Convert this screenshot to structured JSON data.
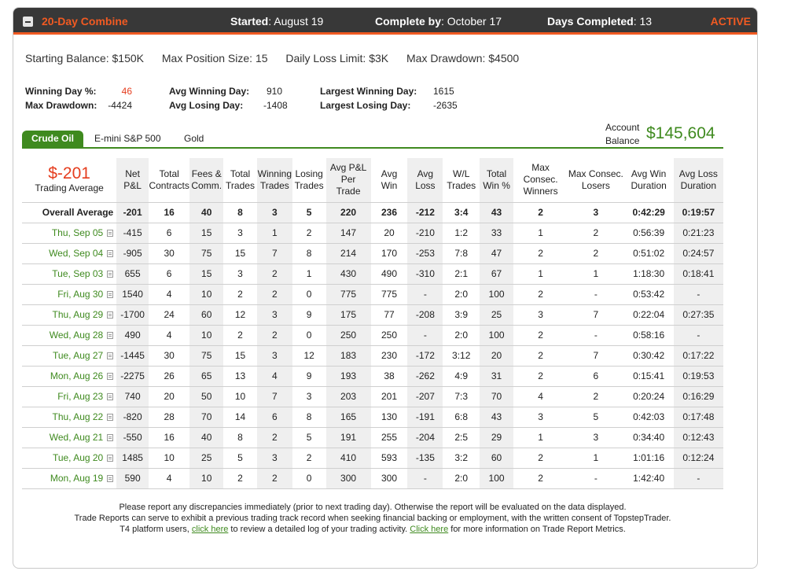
{
  "header": {
    "title": "20-Day Combine",
    "started_label": "Started",
    "started_value": "August 19",
    "complete_label": "Complete by",
    "complete_value": "October 17",
    "days_label": "Days Completed",
    "days_value": "13",
    "status": "ACTIVE"
  },
  "params": {
    "starting_balance": "Starting Balance: $150K",
    "max_position": "Max Position Size: 15",
    "daily_loss": "Daily Loss Limit: $3K",
    "max_drawdown": "Max Drawdown: $4500"
  },
  "stats": {
    "winning_day_label": "Winning Day %:",
    "winning_day_value": "46",
    "max_drawdown_label": "Max Drawdown:",
    "max_drawdown_value": "-4424",
    "avg_winning_label": "Avg Winning Day:",
    "avg_winning_value": "910",
    "avg_losing_label": "Avg Losing Day:",
    "avg_losing_value": "-1408",
    "largest_winning_label": "Largest Winning Day:",
    "largest_winning_value": "1615",
    "largest_losing_label": "Largest Losing Day:",
    "largest_losing_value": "-2635"
  },
  "tabs": [
    "Crude Oil",
    "E-mini S&P 500",
    "Gold"
  ],
  "account": {
    "label1": "Account",
    "label2": "Balance",
    "value": "$145,604"
  },
  "table": {
    "pnl_big": "$-201",
    "pnl_small": "Trading Average",
    "columns": [
      [
        "Net",
        "P&L"
      ],
      [
        "Total",
        "Contracts"
      ],
      [
        "Fees &",
        "Comm."
      ],
      [
        "Total",
        "Trades"
      ],
      [
        "Winning",
        "Trades"
      ],
      [
        "Losing",
        "Trades"
      ],
      [
        "Avg P&L",
        "Per",
        "Trade"
      ],
      [
        "Avg",
        "Win"
      ],
      [
        "Avg",
        "Loss"
      ],
      [
        "W/L",
        "Trades"
      ],
      [
        "Total",
        "Win %"
      ],
      [
        "Max Consec.",
        "Winners"
      ],
      [
        "Max Consec.",
        "Losers"
      ],
      [
        "Avg Win",
        "Duration"
      ],
      [
        "Avg Loss",
        "Duration"
      ]
    ],
    "overall": [
      "Overall Average",
      "-201",
      "16",
      "40",
      "8",
      "3",
      "5",
      "220",
      "236",
      "-212",
      "3:4",
      "43",
      "2",
      "3",
      "0:42:29",
      "0:19:57"
    ],
    "rows": [
      [
        "Thu, Sep 05",
        "-415",
        "6",
        "15",
        "3",
        "1",
        "2",
        "147",
        "20",
        "-210",
        "1:2",
        "33",
        "1",
        "2",
        "0:56:39",
        "0:21:23"
      ],
      [
        "Wed, Sep 04",
        "-905",
        "30",
        "75",
        "15",
        "7",
        "8",
        "214",
        "170",
        "-253",
        "7:8",
        "47",
        "2",
        "2",
        "0:51:02",
        "0:24:57"
      ],
      [
        "Tue, Sep 03",
        "655",
        "6",
        "15",
        "3",
        "2",
        "1",
        "430",
        "490",
        "-310",
        "2:1",
        "67",
        "1",
        "1",
        "1:18:30",
        "0:18:41"
      ],
      [
        "Fri, Aug 30",
        "1540",
        "4",
        "10",
        "2",
        "2",
        "0",
        "775",
        "775",
        "-",
        "2:0",
        "100",
        "2",
        "-",
        "0:53:42",
        "-"
      ],
      [
        "Thu, Aug 29",
        "-1700",
        "24",
        "60",
        "12",
        "3",
        "9",
        "175",
        "77",
        "-208",
        "3:9",
        "25",
        "3",
        "7",
        "0:22:04",
        "0:27:35"
      ],
      [
        "Wed, Aug 28",
        "490",
        "4",
        "10",
        "2",
        "2",
        "0",
        "250",
        "250",
        "-",
        "2:0",
        "100",
        "2",
        "-",
        "0:58:16",
        "-"
      ],
      [
        "Tue, Aug 27",
        "-1445",
        "30",
        "75",
        "15",
        "3",
        "12",
        "183",
        "230",
        "-172",
        "3:12",
        "20",
        "2",
        "7",
        "0:30:42",
        "0:17:22"
      ],
      [
        "Mon, Aug 26",
        "-2275",
        "26",
        "65",
        "13",
        "4",
        "9",
        "193",
        "38",
        "-262",
        "4:9",
        "31",
        "2",
        "6",
        "0:15:41",
        "0:19:53"
      ],
      [
        "Fri, Aug 23",
        "740",
        "20",
        "50",
        "10",
        "7",
        "3",
        "203",
        "201",
        "-207",
        "7:3",
        "70",
        "4",
        "2",
        "0:20:24",
        "0:16:29"
      ],
      [
        "Thu, Aug 22",
        "-820",
        "28",
        "70",
        "14",
        "6",
        "8",
        "165",
        "130",
        "-191",
        "6:8",
        "43",
        "3",
        "5",
        "0:42:03",
        "0:17:48"
      ],
      [
        "Wed, Aug 21",
        "-550",
        "16",
        "40",
        "8",
        "2",
        "5",
        "191",
        "255",
        "-204",
        "2:5",
        "29",
        "1",
        "3",
        "0:34:40",
        "0:12:43"
      ],
      [
        "Tue, Aug 20",
        "1485",
        "10",
        "25",
        "5",
        "3",
        "2",
        "410",
        "593",
        "-135",
        "3:2",
        "60",
        "2",
        "1",
        "1:01:16",
        "0:12:24"
      ],
      [
        "Mon, Aug 19",
        "590",
        "4",
        "10",
        "2",
        "2",
        "0",
        "300",
        "300",
        "-",
        "2:0",
        "100",
        "2",
        "-",
        "1:42:40",
        "-"
      ]
    ]
  },
  "footer": {
    "line1": "Please report any discrepancies immediately (prior to next trading day). Otherwise the report will be evaluated on the data displayed.",
    "line2": "Trade Reports can serve to exhibit a previous trading track record when seeking financial backing or employment, with the written consent of TopstepTrader.",
    "line3_a": "T4 platform users, ",
    "link1": "click here",
    "line3_b": " to review a detailed log of your trading activity. ",
    "link2": "Click here",
    "line3_c": " for more information on Trade Report Metrics."
  }
}
